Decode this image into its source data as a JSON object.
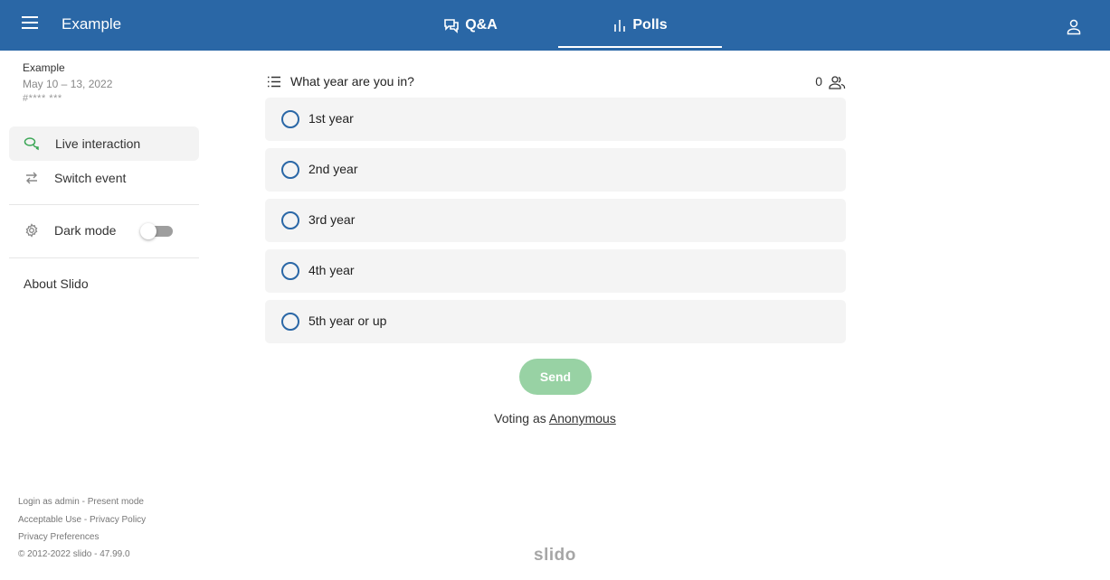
{
  "header": {
    "event_title": "Example",
    "tabs": [
      {
        "label": "Q&A",
        "icon": "chat-bubbles-icon",
        "active": false
      },
      {
        "label": "Polls",
        "icon": "bar-chart-icon",
        "active": true
      }
    ],
    "bg_color": "#2a67a6"
  },
  "sidebar": {
    "event_name": "Example",
    "event_dates": "May 10 – 13, 2022",
    "event_code": "#**** ***",
    "items": [
      {
        "label": "Live interaction",
        "icon": "chat-bubbles-icon",
        "active": true
      },
      {
        "label": "Switch event",
        "icon": "switch-arrows-icon"
      }
    ],
    "dark_mode": {
      "label": "Dark mode",
      "icon": "gear-icon",
      "enabled": false
    },
    "about": "About Slido",
    "footer": {
      "login_admin": "Login as admin",
      "present_mode": "Present mode",
      "acceptable_use": "Acceptable Use",
      "privacy_policy": "Privacy Policy",
      "privacy_prefs": "Privacy Preferences",
      "copyright": "© 2012-2022 slido - 47.99.0",
      "sep": " - "
    }
  },
  "poll": {
    "question": "What year are you in?",
    "participants": "0",
    "options": [
      "1st year",
      "2nd year",
      "3rd year",
      "4th year",
      "5th year or up"
    ],
    "send_label": "Send",
    "voting_prefix": "Voting as ",
    "voting_identity": "Anonymous"
  },
  "brand": "slido",
  "colors": {
    "accent": "#2a67a6",
    "send": "#98d2a4",
    "live_icon": "#3aa655"
  }
}
